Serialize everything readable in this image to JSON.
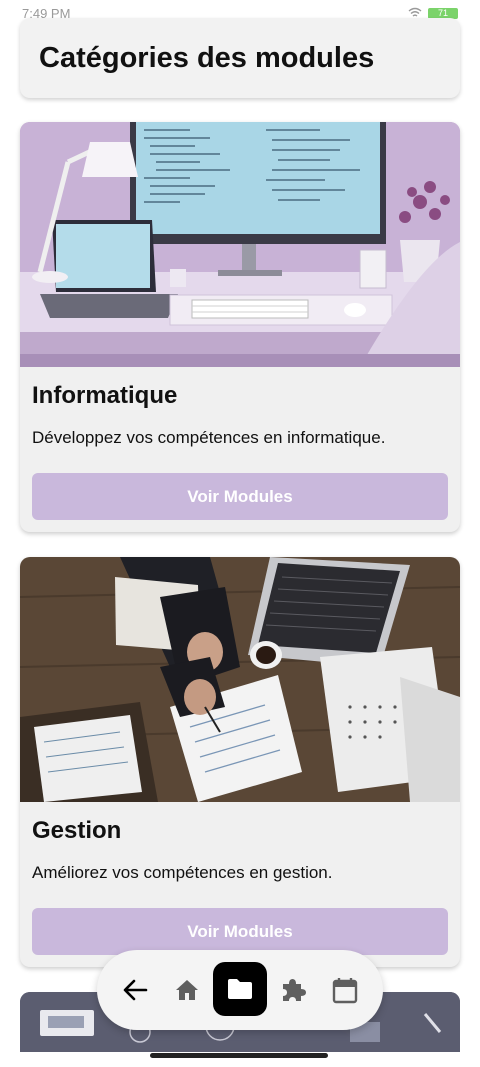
{
  "status_bar": {
    "time": "7:49 PM",
    "battery": "71"
  },
  "header": {
    "title": "Catégories des modules"
  },
  "cards": [
    {
      "title": "Informatique",
      "description": "Développez vos compétences en informatique.",
      "button_label": "Voir Modules",
      "image": "desk-computer-image"
    },
    {
      "title": "Gestion",
      "description": "Améliorez vos compétences en gestion.",
      "button_label": "Voir Modules",
      "image": "business-documents-image"
    }
  ],
  "nav": {
    "items": [
      "back-arrow-icon",
      "home-icon",
      "folder-icon",
      "puzzle-icon",
      "calendar-icon"
    ],
    "active": "folder-icon"
  },
  "colors": {
    "button": "#c9b8dc",
    "card_bg": "#f0f0f0",
    "nav_active": "#000000"
  }
}
